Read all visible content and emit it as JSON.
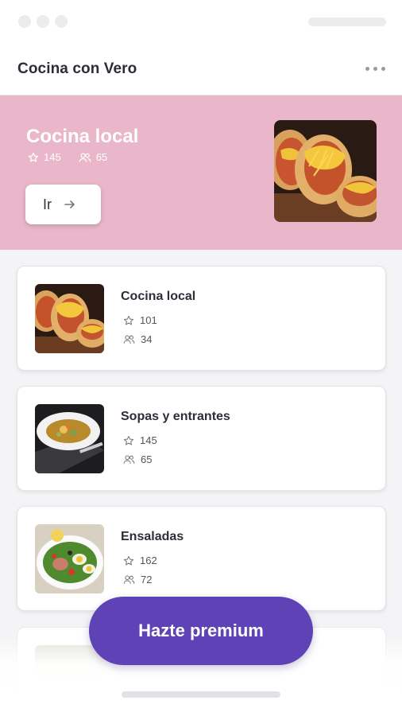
{
  "app": {
    "title": "Cocina con Vero"
  },
  "icons": {
    "more": "more-horizontal-icon",
    "star": "star-icon",
    "users": "users-icon",
    "arrow": "arrow-right-icon"
  },
  "colors": {
    "hero_bg": "#e9b7c9",
    "premium_bg": "#5e42b6",
    "title_text": "#2c2e37"
  },
  "hero": {
    "title": "Cocina local",
    "stars": "145",
    "users": "65",
    "button_label": "Ir"
  },
  "categories": [
    {
      "title": "Cocina local",
      "stars": "101",
      "users": "34",
      "image": "arepas-photo"
    },
    {
      "title": "Sopas y entrantes",
      "stars": "145",
      "users": "65",
      "image": "soup-photo"
    },
    {
      "title": "Ensaladas",
      "stars": "162",
      "users": "72",
      "image": "salad-photo"
    }
  ],
  "premium": {
    "label": "Hazte premium"
  }
}
